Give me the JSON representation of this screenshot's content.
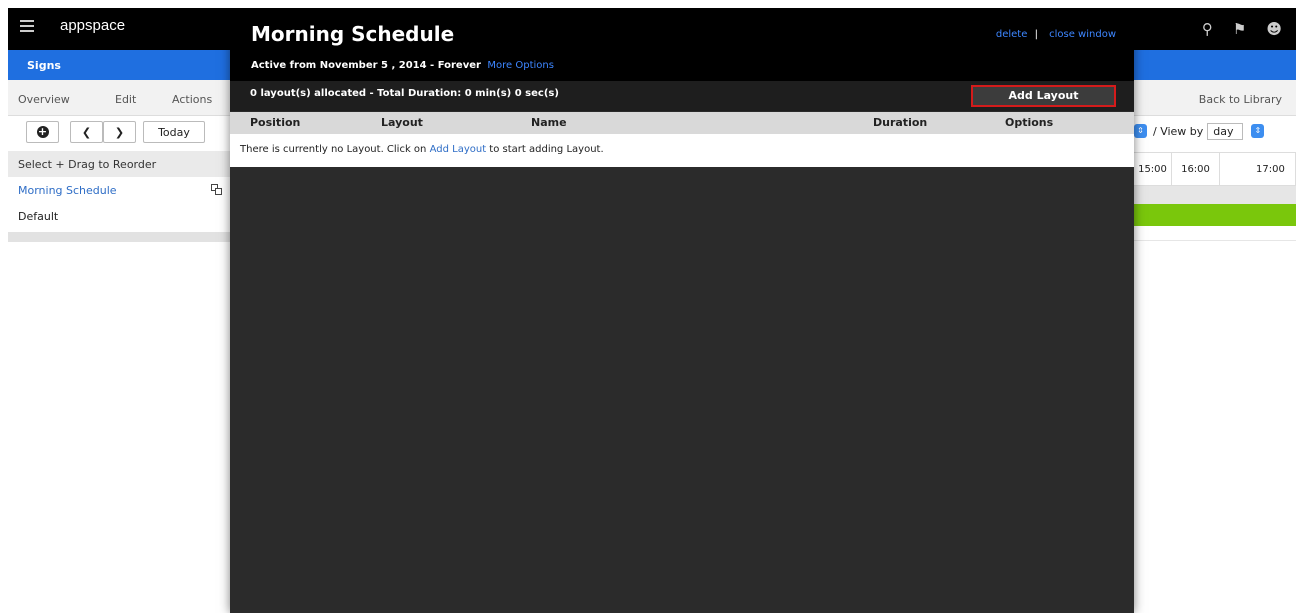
{
  "app": {
    "brand": "appspace",
    "section": "Signs"
  },
  "left_panel": {
    "tabs": [
      "Overview",
      "Edit",
      "Actions"
    ],
    "today_label": "Today",
    "reorder_hint": "Select + Drag to Reorder",
    "schedules": [
      "Morning Schedule",
      "Default"
    ]
  },
  "right_panel": {
    "back_label": "Back to Library",
    "view_by_label": "/ View by",
    "view_by_value": "day",
    "times": [
      "15:00",
      "16:00",
      "17:00"
    ]
  },
  "modal": {
    "title": "Morning Schedule",
    "active_text": "Active from November 5 , 2014 - Forever",
    "more_options": "More Options",
    "delete_label": "delete",
    "separator": "|",
    "close_label": "close window",
    "allocated_text": "0 layout(s) allocated - Total Duration: 0 min(s) 0 sec(s)",
    "add_layout_button": "Add Layout",
    "columns": [
      "Position",
      "Layout",
      "Name",
      "Duration",
      "Options"
    ],
    "empty_before": "There is currently no Layout. Click on ",
    "empty_link": "Add Layout",
    "empty_after": " to start adding Layout."
  },
  "colors": {
    "top_bar": "#000000",
    "signs_bar": "#1f6fe0",
    "link": "#3d86ff",
    "highlight_border": "#d41b1b",
    "timeline_green": "#7ac70c"
  }
}
